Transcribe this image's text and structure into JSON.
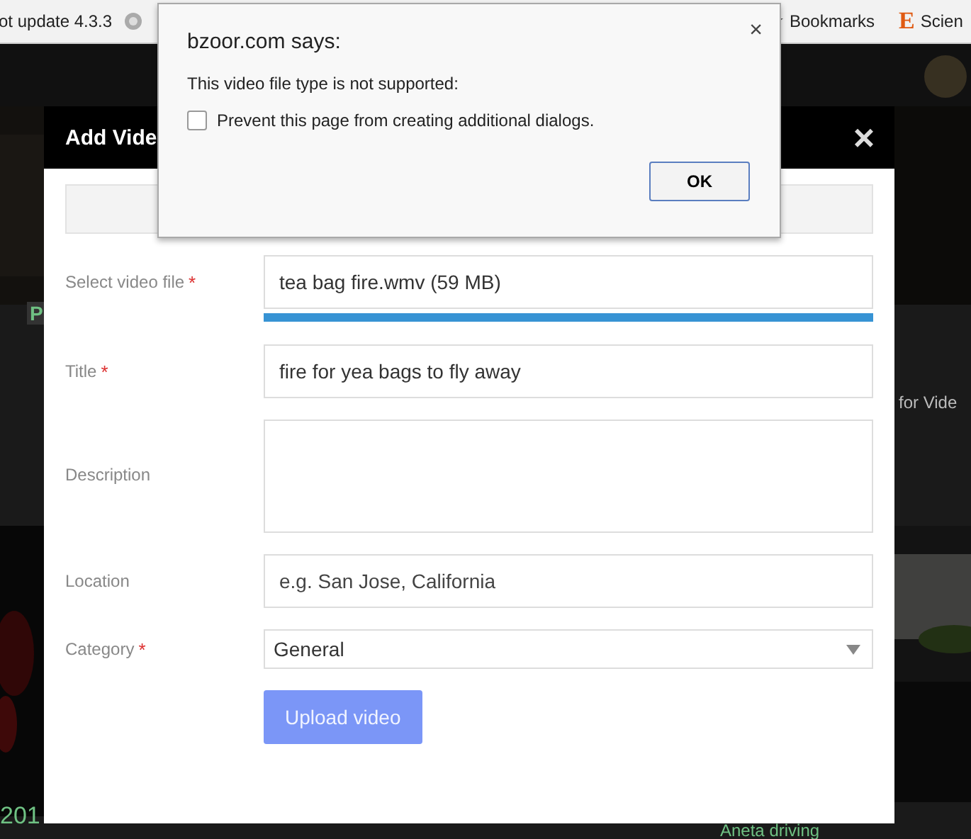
{
  "browser": {
    "bookmarks": [
      {
        "kind": "text",
        "label": "ot update 4.3.3"
      },
      {
        "kind": "star",
        "label": "Bookmarks"
      },
      {
        "kind": "letter",
        "label": "Scien",
        "glyph": "E"
      }
    ]
  },
  "page": {
    "nav_fragment": "P",
    "heading_fragment": "for Vide",
    "date_fragment": "201",
    "video_title": "Aneta driving"
  },
  "modal": {
    "title": "Add Vide",
    "close": "×",
    "fields": [
      {
        "kind": "file",
        "label": "Select video file",
        "required_mark": "*",
        "value": "tea bag fire.wmv (59 MB)",
        "level": 1
      },
      {
        "kind": "text",
        "label": "Title",
        "required_mark": "*",
        "value": "fire for yea bags to fly away"
      },
      {
        "kind": "textarea",
        "label": "Description"
      },
      {
        "kind": "text",
        "label": "Location",
        "placeholder": "e.g. San Jose, California"
      },
      {
        "kind": "select",
        "label": "Category",
        "required_mark": "*",
        "value": "General"
      }
    ],
    "submit": {
      "label": "Upload video",
      "disabled": true
    }
  },
  "alert": {
    "origin": "bzoor.com says:",
    "close": "×",
    "message": "This video file type is not supported:",
    "checkbox": {
      "label": "Prevent this page from creating additional dialogs.",
      "checked": false
    },
    "button": "OK"
  }
}
